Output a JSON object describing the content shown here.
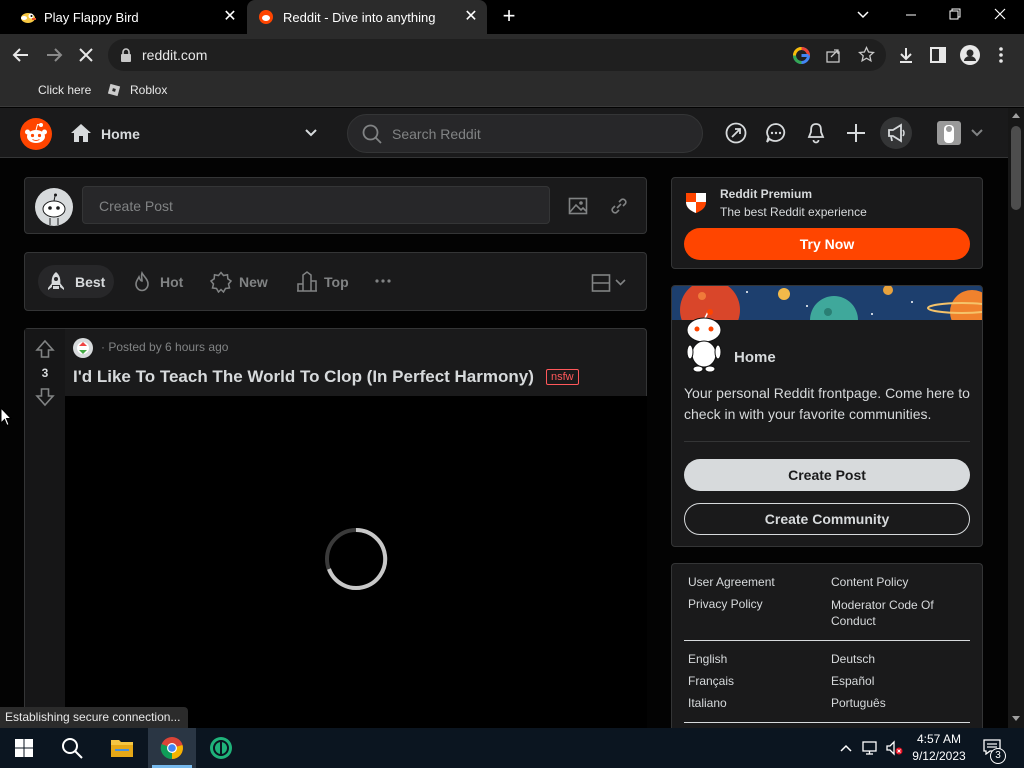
{
  "browser": {
    "tabs": [
      {
        "title": "Play Flappy Bird"
      },
      {
        "title": "Reddit - Dive into anything"
      }
    ],
    "url": "reddit.com",
    "bookmarks": [
      {
        "label": "Click here"
      },
      {
        "label": "Roblox"
      }
    ],
    "status_text": "Establishing secure connection..."
  },
  "reddit": {
    "home_label": "Home",
    "search_placeholder": "Search Reddit",
    "create_post_placeholder": "Create Post",
    "sort": {
      "best": "Best",
      "hot": "Hot",
      "new": "New",
      "top": "Top"
    },
    "post": {
      "meta": "· Posted by 6 hours ago",
      "votes": "3",
      "title": "I'd Like To Teach The World To Clop (In Perfect Harmony)",
      "flair": "nsfw"
    },
    "premium": {
      "title": "Reddit Premium",
      "subtitle": "The best Reddit experience",
      "button": "Try Now"
    },
    "home_card": {
      "title": "Home",
      "description": "Your personal Reddit frontpage. Come here to check in with your favorite communities.",
      "create_post": "Create Post",
      "create_community": "Create Community"
    },
    "footer_links": {
      "col1": [
        "User Agreement",
        "Privacy Policy"
      ],
      "col2": [
        "Content Policy",
        "Moderator Code Of Conduct"
      ],
      "lang_col1": [
        "English",
        "Français",
        "Italiano"
      ],
      "lang_col2": [
        "Deutsch",
        "Español",
        "Português"
      ]
    }
  },
  "taskbar": {
    "time": "4:57 AM",
    "date": "9/12/2023",
    "notification_count": "3"
  },
  "colors": {
    "reddit_orange": "#ff4500",
    "nsfw_red": "#ff585b",
    "text_primary": "#d7dadc",
    "text_muted": "#818384"
  }
}
